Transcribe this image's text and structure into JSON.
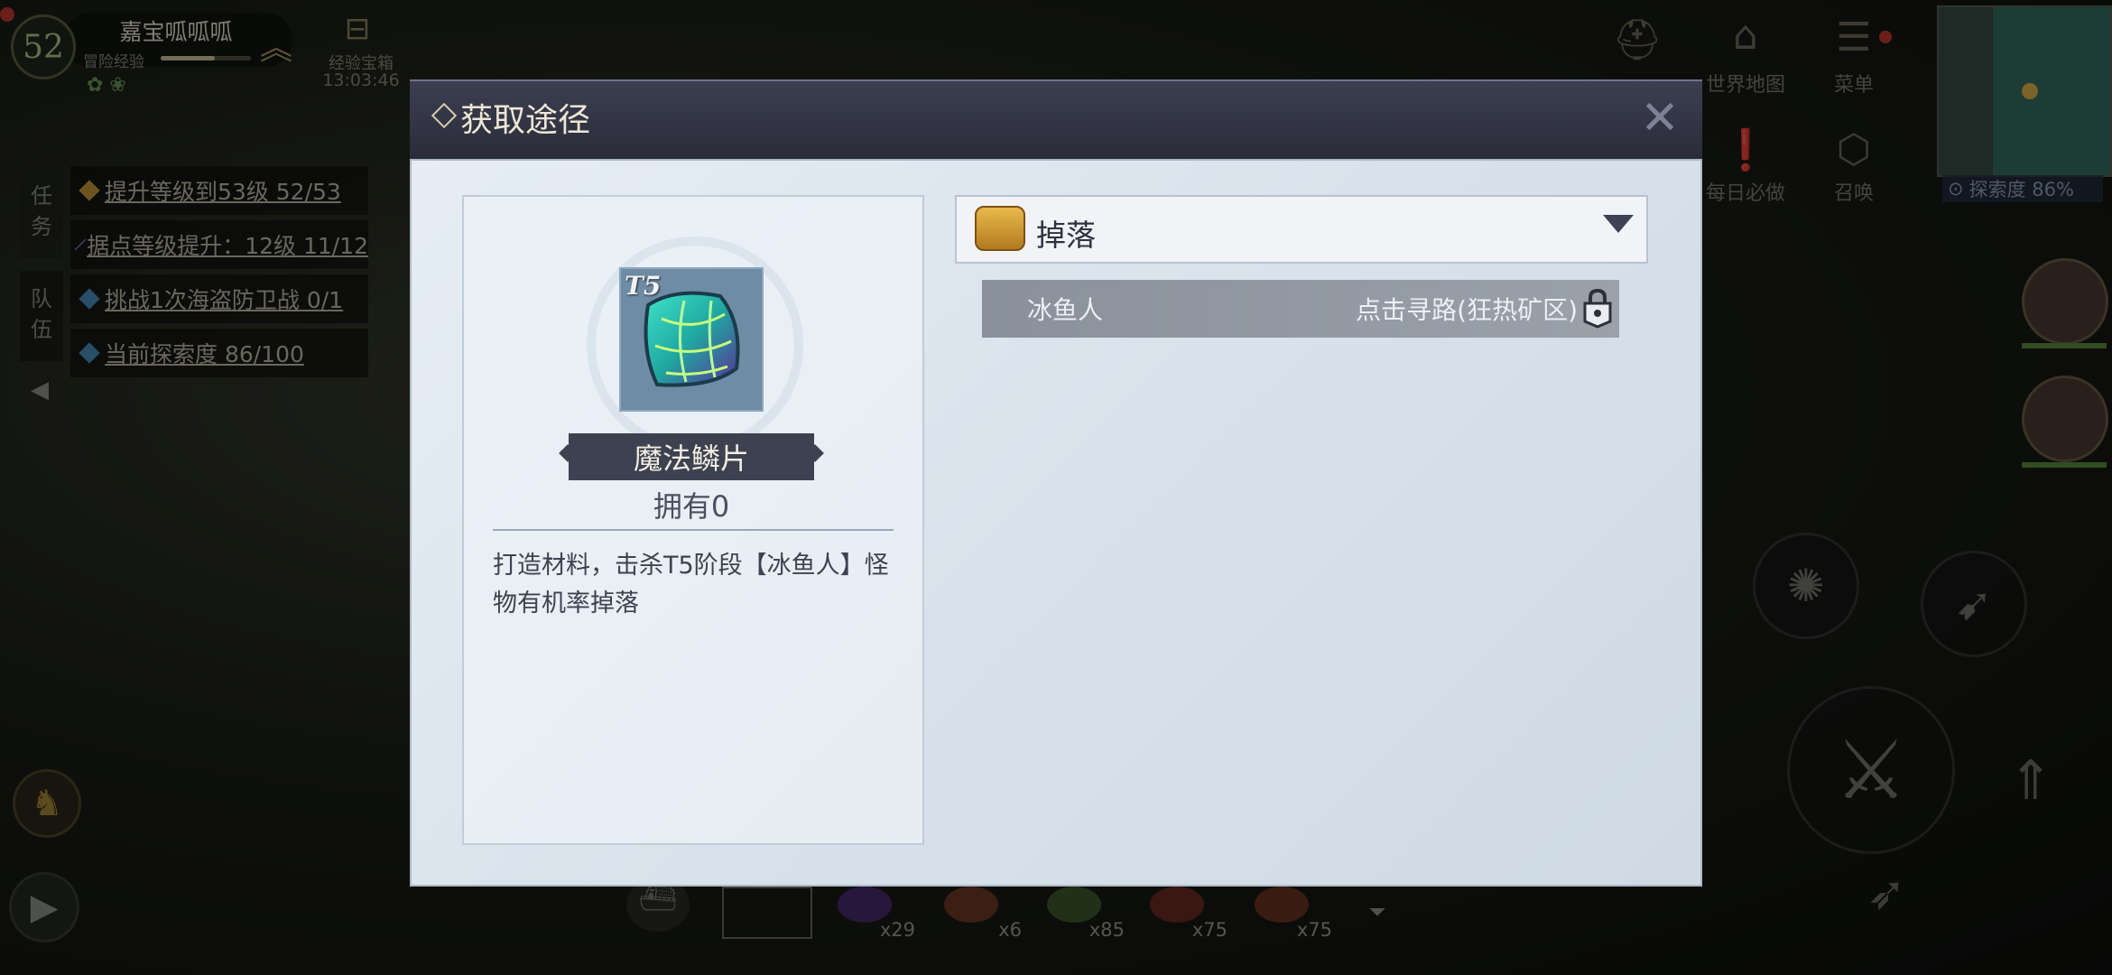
{
  "hud": {
    "level": "52",
    "player_name": "嘉宝呱呱呱",
    "exp_label": "冒险经验",
    "exp_progress": 0.6,
    "chest_label": "经验宝箱",
    "chest_timer": "13:03:46",
    "side_tabs": [
      "任务",
      "队伍"
    ],
    "quests": [
      {
        "text": "提升等级到53级 52/53",
        "color": "#c79a3a"
      },
      {
        "text": "据点等级提升：12级 11/12",
        "color": "#7a6fb8"
      },
      {
        "text": "挑战1次海盗防卫战 0/1",
        "color": "#4b8fbf"
      },
      {
        "text": "当前探索度 86/100",
        "color": "#4b8fbf"
      }
    ],
    "top_right": [
      {
        "icon": "helmet-icon",
        "label": ""
      },
      {
        "icon": "world-map-icon",
        "label": "世界地图"
      },
      {
        "icon": "menu-icon",
        "label": "菜单"
      },
      {
        "icon": "daily-icon",
        "label": "每日必做"
      },
      {
        "icon": "summon-icon",
        "label": "召唤"
      }
    ],
    "exploration": "探索度 86%",
    "bottom_slots": [
      "x29",
      "x6",
      "x85",
      "x75",
      "x75"
    ]
  },
  "dialog": {
    "title": "获取途径",
    "item": {
      "tier": "T5",
      "name": "魔法鳞片",
      "owned": "拥有0",
      "description": "打造材料，击杀T5阶段【冰鱼人】怪物有机率掉落"
    },
    "source": {
      "category": "掉落",
      "rows": [
        {
          "monster": "冰鱼人",
          "path": "点击寻路(狂热矿区)"
        }
      ]
    }
  }
}
